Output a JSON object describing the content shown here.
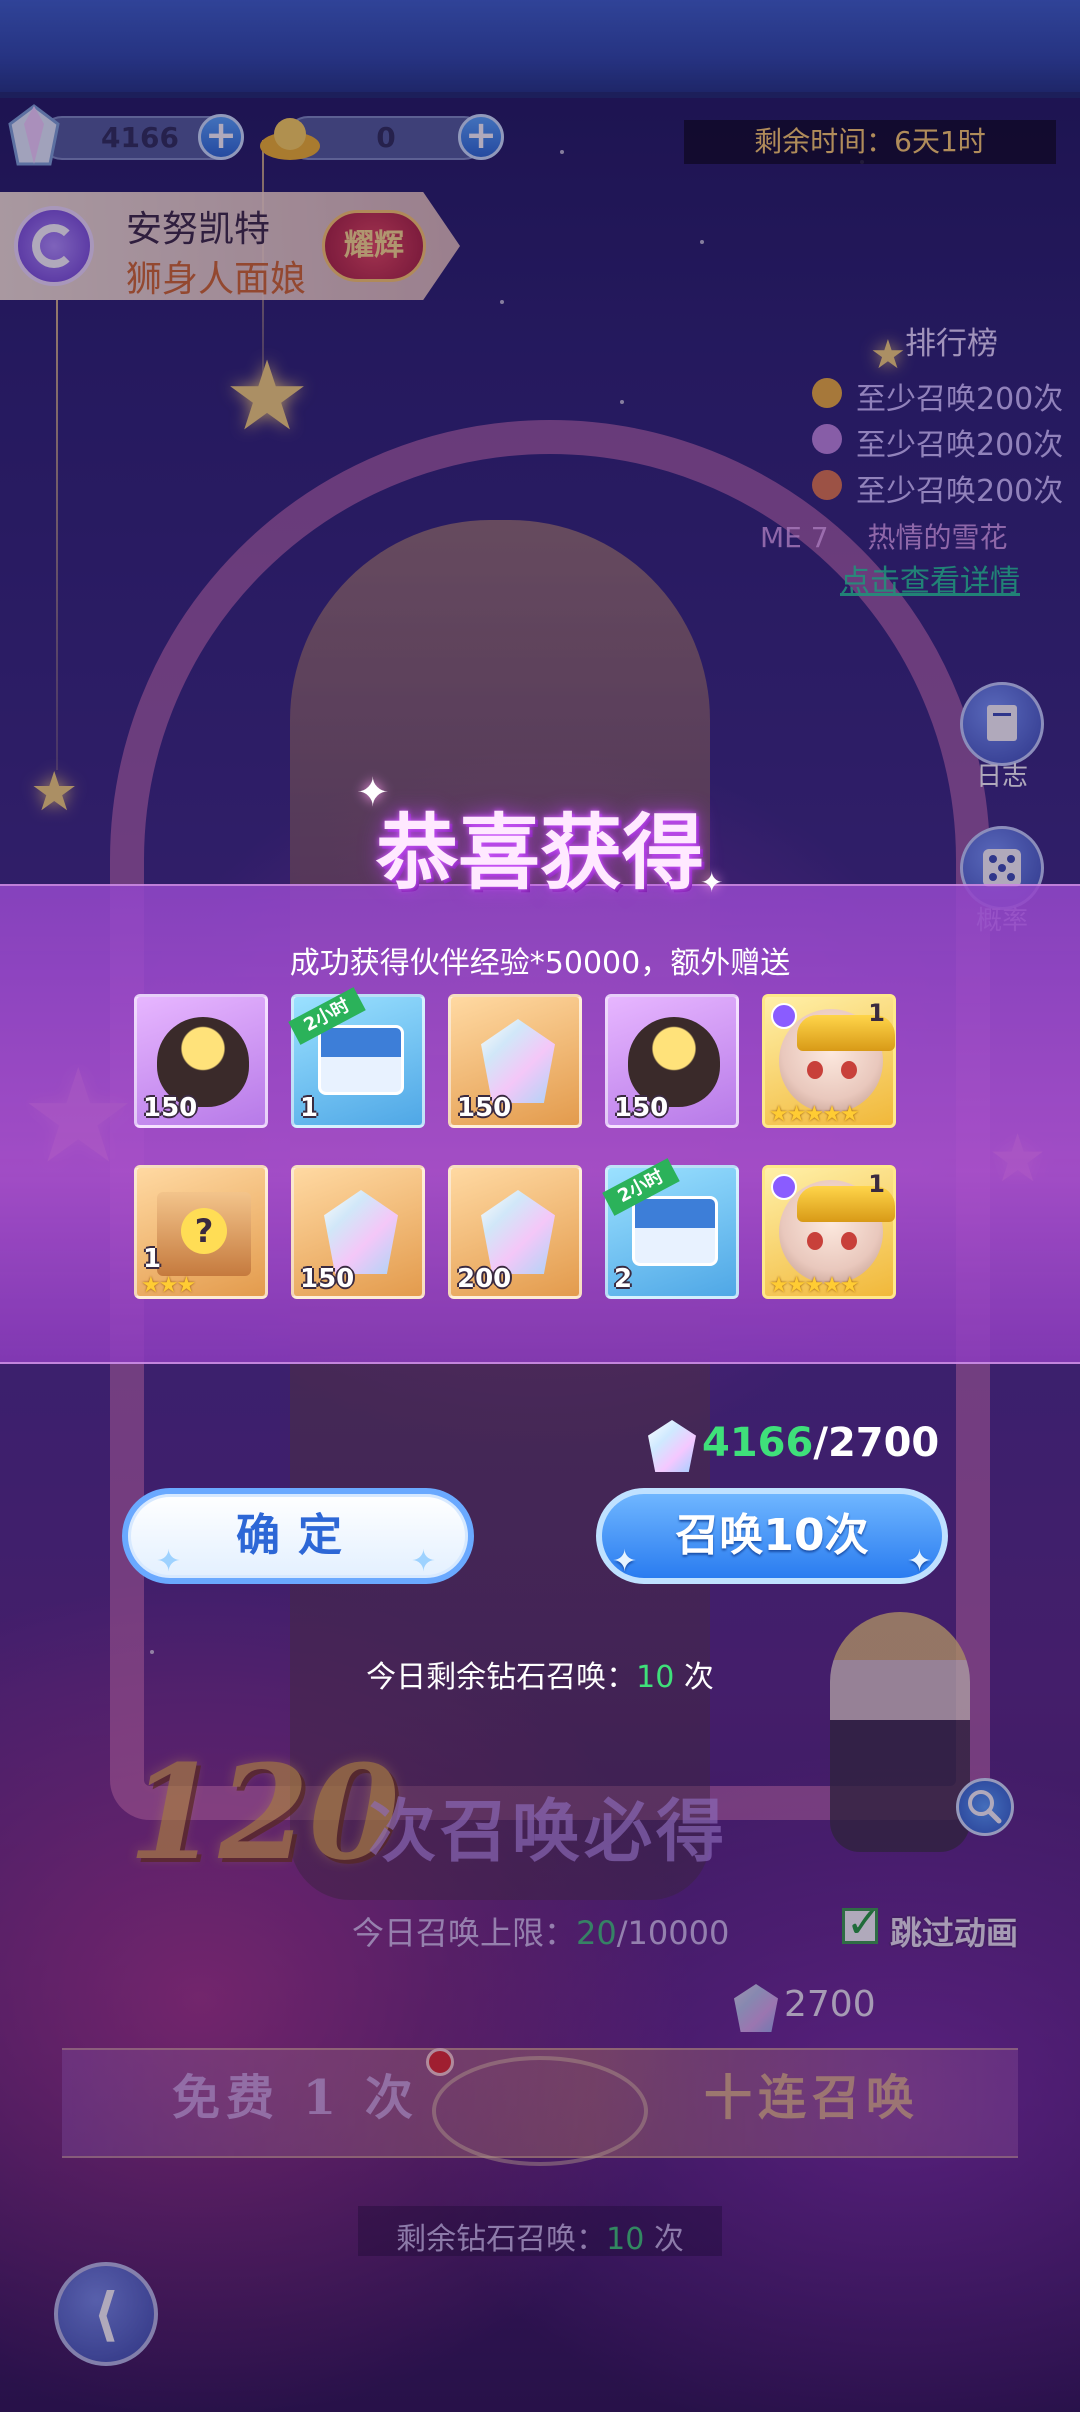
{
  "currency": {
    "gems": "4166",
    "gold": "0",
    "add_label": "+"
  },
  "timer": {
    "text": "剩余时间：6天1时"
  },
  "hero": {
    "name": "安努凯特",
    "title": "狮身人面娘",
    "badge": "耀辉"
  },
  "ranking": {
    "title": "排行榜",
    "rows": [
      {
        "text": "至少召唤200次",
        "medal_color": "#f0b43a"
      },
      {
        "text": "至少召唤200次",
        "medal_color": "#c08ae0"
      },
      {
        "text": "至少召唤200次",
        "medal_color": "#e07a4a"
      }
    ],
    "me_text": "ME 7",
    "me_name": "热情的雪花",
    "link": "点击查看详情"
  },
  "side_buttons": {
    "log": "日志",
    "probability": "概率"
  },
  "reward": {
    "title": "恭喜获得",
    "description": "成功获得伙伴经验*50000，额外赠送",
    "items": [
      {
        "kind": "egg",
        "bg": "purple",
        "qty": "150",
        "tag": ""
      },
      {
        "kind": "chest",
        "bg": "blue",
        "qty": "1",
        "tag": "2小时"
      },
      {
        "kind": "gem",
        "bg": "orange",
        "qty": "150",
        "tag": ""
      },
      {
        "kind": "egg",
        "bg": "purple",
        "qty": "150",
        "tag": ""
      },
      {
        "kind": "hero",
        "bg": "gold",
        "qty": "",
        "tag": "",
        "level": "1",
        "stars": "★★★★★"
      },
      {
        "kind": "crate",
        "bg": "orange",
        "qty": "1",
        "tag": "",
        "stars": "★★★"
      },
      {
        "kind": "gem",
        "bg": "orange",
        "qty": "150",
        "tag": ""
      },
      {
        "kind": "gem",
        "bg": "orange",
        "qty": "200",
        "tag": ""
      },
      {
        "kind": "chest",
        "bg": "blue",
        "qty": "2",
        "tag": "2小时"
      },
      {
        "kind": "hero",
        "bg": "gold",
        "qty": "",
        "tag": "",
        "level": "1",
        "stars": "★★★★★"
      }
    ]
  },
  "cost": {
    "have": "4166",
    "sep": "/",
    "need": "2700"
  },
  "buttons": {
    "confirm": "确定",
    "summon": "召唤10次"
  },
  "today_remaining": {
    "prefix": "今日剩余钻石召唤：",
    "count": "10",
    "suffix": " 次"
  },
  "guarantee": {
    "number": "120",
    "label": "次召唤必得"
  },
  "limit": {
    "prefix": "今日召唤上限：",
    "count": "20",
    "max": "/10000"
  },
  "skip": {
    "label": "跳过动画",
    "checked": true
  },
  "price": {
    "value": "2700"
  },
  "bottom": {
    "free": "免费 1 次",
    "ten": "十连召唤"
  },
  "remaining_bottom": {
    "prefix": "剩余钻石召唤：",
    "count": "10",
    "suffix": " 次"
  }
}
